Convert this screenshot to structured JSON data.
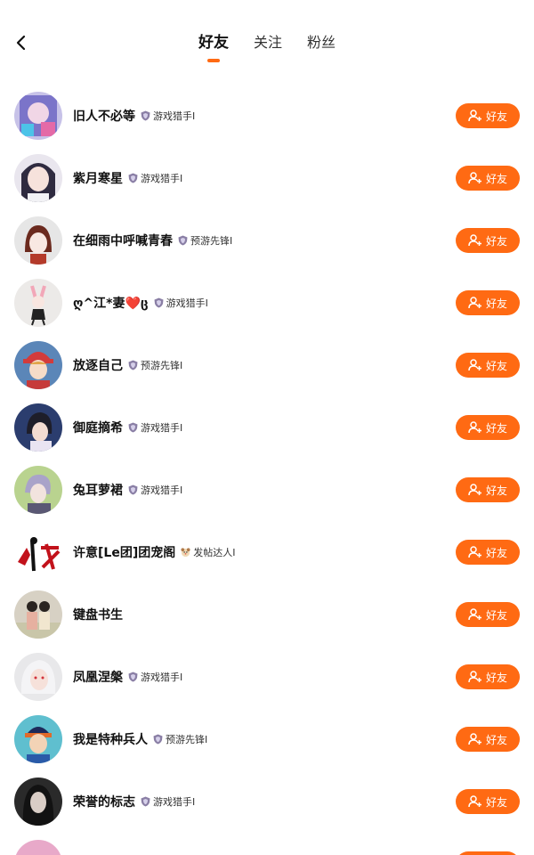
{
  "header": {
    "back_icon": "chevron-left-icon",
    "tabs": [
      {
        "label": "好友",
        "active": true
      },
      {
        "label": "关注",
        "active": false
      },
      {
        "label": "粉丝",
        "active": false
      }
    ]
  },
  "colors": {
    "accent": "#ff6a13",
    "badge_icon": "#8a7fa5"
  },
  "action_button": {
    "label": "好友",
    "icon": "add-user-icon"
  },
  "users": [
    {
      "name": "旧人不必等",
      "badge": "游戏猎手Ⅰ",
      "badge_icon": "shield-icon"
    },
    {
      "name": "紫月寒星",
      "badge": "游戏猎手Ⅰ",
      "badge_icon": "shield-icon"
    },
    {
      "name": "在细雨中呼喊青春",
      "badge": "预游先锋Ⅰ",
      "badge_icon": "shield-icon"
    },
    {
      "name": "ღ^江*妻❤️ც",
      "badge": "游戏猎手Ⅰ",
      "badge_icon": "shield-icon"
    },
    {
      "name": "放逐自己",
      "badge": "预游先锋Ⅰ",
      "badge_icon": "shield-icon"
    },
    {
      "name": "御庭摘希",
      "badge": "游戏猎手Ⅰ",
      "badge_icon": "shield-icon"
    },
    {
      "name": "兔耳萝裙",
      "badge": "游戏猎手Ⅰ",
      "badge_icon": "shield-icon"
    },
    {
      "name": "许意[Le团]团宠阁",
      "badge": "发帖达人Ⅰ",
      "badge_icon": "dog-icon"
    },
    {
      "name": "键盘书生",
      "badge": "",
      "badge_icon": ""
    },
    {
      "name": "凤凰涅槃",
      "badge": "游戏猎手Ⅰ",
      "badge_icon": "shield-icon"
    },
    {
      "name": "我是特种兵人",
      "badge": "预游先锋Ⅰ",
      "badge_icon": "shield-icon"
    },
    {
      "name": "荣誉的标志",
      "badge": "游戏猎手Ⅰ",
      "badge_icon": "shield-icon"
    }
  ]
}
